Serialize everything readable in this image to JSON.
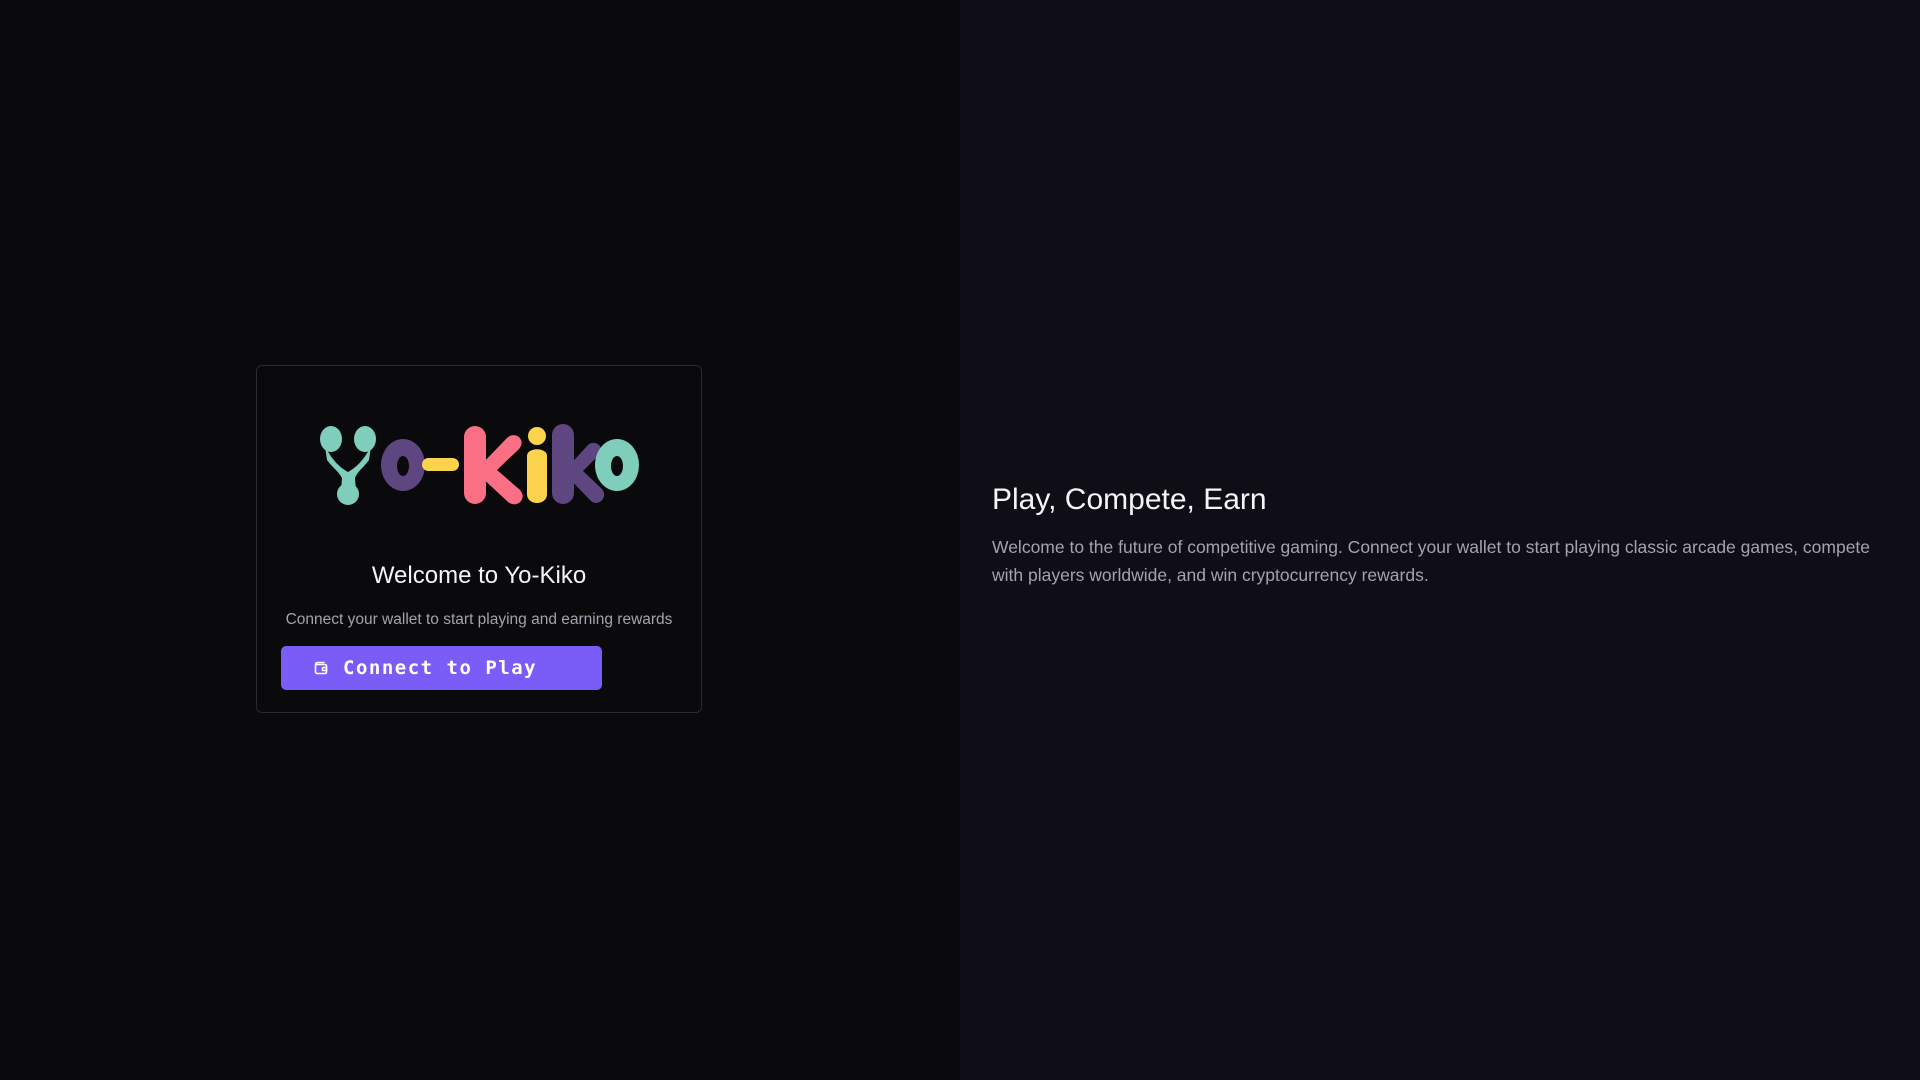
{
  "brand": {
    "logo_text": "Yo-Kiko",
    "colors": {
      "teal": "#7fcdbb",
      "purple": "#5e4780",
      "yellow": "#fcd34d",
      "pink": "#fb6f84"
    }
  },
  "login_card": {
    "title": "Welcome to Yo-Kiko",
    "subtitle": "Connect your wallet to start playing and earning rewards",
    "connect_button": {
      "label": "Connect to Play",
      "icon": "wallet-icon",
      "color": "#7a5cf7"
    }
  },
  "hero": {
    "title": "Play, Compete, Earn",
    "body": "Welcome to the future of competitive gaming. Connect your wallet to start playing classic arcade games, compete with players worldwide, and win cryptocurrency rewards."
  },
  "theme": {
    "left_background": "#0a0a0c",
    "right_background": "#0f0e17"
  }
}
